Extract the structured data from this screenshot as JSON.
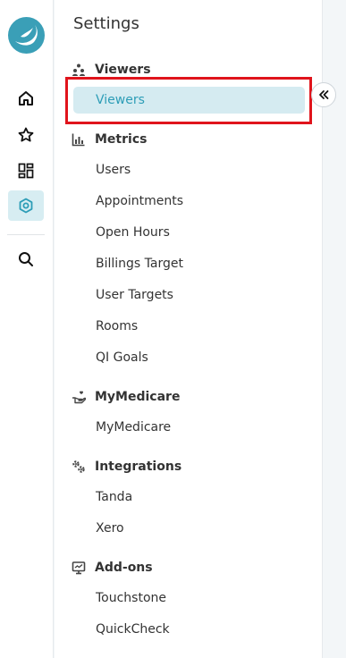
{
  "rail": {
    "logo_icon": "logo-icon",
    "items": [
      {
        "icon": "home-icon"
      },
      {
        "icon": "star-icon"
      },
      {
        "icon": "dashboard-icon"
      },
      {
        "icon": "settings-icon",
        "active": true
      },
      {
        "icon": "search-icon"
      }
    ]
  },
  "panel": {
    "title": "Settings",
    "sections": [
      {
        "label": "Viewers",
        "icon": "viewers-icon",
        "items": [
          "Viewers"
        ],
        "active_item": "Viewers"
      },
      {
        "label": "Metrics",
        "icon": "metrics-icon",
        "items": [
          "Users",
          "Appointments",
          "Open Hours",
          "Billings Target",
          "User Targets",
          "Rooms",
          "QI Goals"
        ]
      },
      {
        "label": "MyMedicare",
        "icon": "hand-heart-icon",
        "items": [
          "MyMedicare"
        ]
      },
      {
        "label": "Integrations",
        "icon": "integrations-icon",
        "items": [
          "Tanda",
          "Xero"
        ]
      },
      {
        "label": "Add-ons",
        "icon": "addons-icon",
        "items": [
          "Touchstone",
          "QuickCheck"
        ]
      }
    ]
  },
  "collapse_button": {
    "icon": "double-chevron-left-icon"
  },
  "colors": {
    "accent": "#2d9db7",
    "active_bg": "#d5ebf1",
    "highlight": "#e0141c"
  }
}
